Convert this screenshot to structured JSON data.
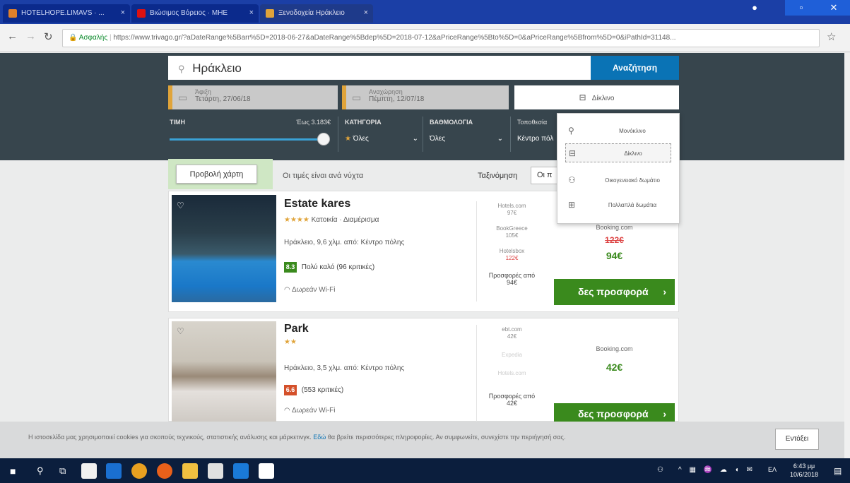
{
  "browser": {
    "tabs": [
      {
        "label": "HOTELHOPE.LIMAVS · ..."
      },
      {
        "label": "Βιώσιμος Βόρειος · ΜΗΕ"
      },
      {
        "label": "Ξενοδοχεία Ηράκλειο"
      }
    ],
    "url_secure": "Ασφαλής",
    "url": "https://www.trivago.gr/?aDateRange%5Barr%5D=2018-06-27&aDateRange%5Bdep%5D=2018-07-12&aPriceRange%5Bto%5D=0&aPriceRange%5Bfrom%5D=0&iPathId=31148..."
  },
  "search": {
    "query": "Ηράκλειο",
    "button": "Αναζήτηση",
    "checkin_label": "Άφιξη",
    "checkin_date": "Τετάρτη, 27/06/18",
    "checkout_label": "Αναχώρηση",
    "checkout_date": "Πέμπτη, 12/07/18",
    "room": "Δίκλινο"
  },
  "filters": {
    "price_label": "ΤΙΜΗ",
    "price_value": "Έως 3.183€",
    "price_slider_level": 1.0,
    "category_label": "ΚΑΤΗΓΟΡΙΑ",
    "category_value": "Όλες",
    "rating_label": "ΒΑΘΜΟΛΟΓΙΑ",
    "rating_value": "Όλες",
    "location_label": "Τοποθεσία",
    "location_value": "Κέντρο πόλ"
  },
  "room_menu": {
    "items": [
      {
        "label": "Μονόκλινο"
      },
      {
        "label": "Δίκλινο"
      },
      {
        "label": "Οικογενειακό δωμάτιο"
      },
      {
        "label": "Πολλαπλά δωμάτια"
      }
    ]
  },
  "results": {
    "map_button": "Προβολή χάρτη",
    "price_note": "Οι τιμές είναι ανά νύχτα",
    "sort_label": "Ταξινόμηση",
    "sort_value": "Οι π",
    "hotels": [
      {
        "name": "Estate kares",
        "stars": "★★★★",
        "type": "Κατοικία · Διαμέρισμα",
        "location": "Ηράκλειο, 9,6 χλμ. από: Κέντρο πόλης",
        "score": "8.3",
        "score_text": "Πολύ καλό (96 κριτικές)",
        "amenity": "Δωρεάν Wi-Fi",
        "offers": [
          {
            "site": "Hotels.com",
            "price": "97€"
          },
          {
            "site": "BookGreece",
            "price": "105€"
          },
          {
            "site": "Hotelsbox",
            "price": "122€"
          }
        ],
        "offers_from": "Προσφορές από",
        "offers_from_price": "94€",
        "main_site": "Booking.com",
        "main_old": "122€",
        "main_price": "94€",
        "deal": "δες προσφορά"
      },
      {
        "name": "Park",
        "stars": "★★",
        "location": "Ηράκλειο, 3,5 χλμ. από: Κέντρο πόλης",
        "score": "6.6",
        "score_text": "(553 κριτικές)",
        "amenity": "Δωρεάν Wi-Fi",
        "offers": [
          {
            "site": "ebt.com",
            "price": "42€"
          },
          {
            "site": "Expedia",
            "price": ""
          },
          {
            "site": "Hotels.com",
            "price": ""
          }
        ],
        "offers_from": "Προσφορές από",
        "offers_from_price": "42€",
        "main_site": "Booking.com",
        "main_price": "42€",
        "deal": "δες προσφορά"
      }
    ]
  },
  "cookie": {
    "text_before": "Η ιστοσελίδα μας χρησιμοποιεί cookies για σκοπούς τεχνικούς, στατιστικής ανάλυσης και μάρκετινγκ.",
    "link": "Εδώ",
    "text_after": "θα βρείτε περισσότερες πληροφορίες. Αν συμφωνείτε, συνεχίστε την περιήγησή σας.",
    "ok": "Εντάξει"
  },
  "taskbar": {
    "lang": "ΕΛ",
    "time": "6:43 μμ",
    "date": "10/6/2018"
  },
  "colors": {
    "header": "#37454d",
    "accent_blue": "#0a73b5",
    "deal_green": "#3a8a1d",
    "star": "#e0a43a"
  }
}
